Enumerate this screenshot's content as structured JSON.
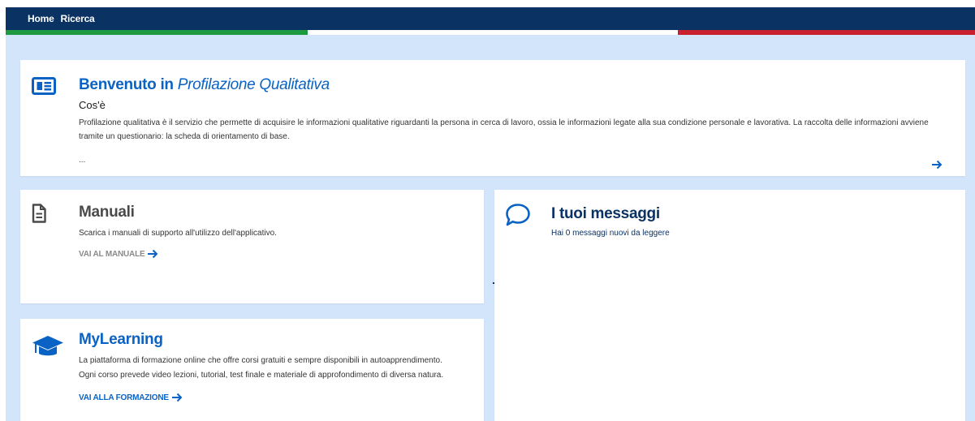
{
  "nav": {
    "home": "Home",
    "ricerca": "Ricerca"
  },
  "welcome": {
    "title_prefix": "Benvenuto in",
    "title_app": "Profilazione Qualitativa",
    "subtitle": "Cos'è",
    "description": "Profilazione qualitativa è il servizio che permette di acquisire le informazioni qualitative riguardanti la persona in cerca di lavoro, ossia le informazioni legate alla sua condizione personale e lavorativa. La raccolta delle informazioni avviene tramite un questionario: la scheda di orientamento di base.",
    "ellipsis": "...",
    "icon": "newspaper-icon"
  },
  "manuali": {
    "title": "Manuali",
    "description": "Scarica i manuali di supporto all'utilizzo dell'applicativo.",
    "link": "VAI AL MANUALE",
    "icon": "document-icon"
  },
  "messaggi": {
    "title": "I tuoi messaggi",
    "description": "Hai 0 messaggi nuovi da leggere",
    "icon": "chat-bubble-icon"
  },
  "learning": {
    "title": "MyLearning",
    "description_1": "La piattaforma di formazione online che offre corsi gratuiti e sempre disponibili in autoapprendimento.",
    "description_2": "Ogni corso prevede video lezioni, tutorial, test finale e materiale di approfondimento di diversa natura.",
    "link": "VAI ALLA FORMAZIONE",
    "icon": "graduation-cap-icon"
  },
  "colors": {
    "header": "#0a3263",
    "accent_blue": "#0a63c4",
    "background": "#d3e5fb",
    "flag_green": "#1d9a40",
    "flag_red": "#c8202f"
  }
}
